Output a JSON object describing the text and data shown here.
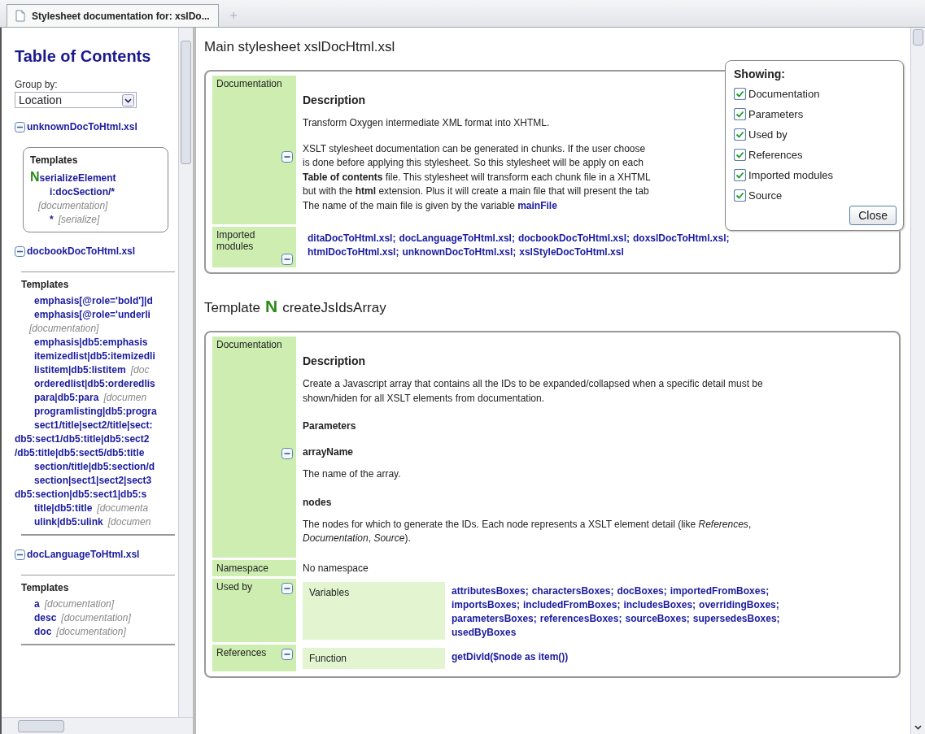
{
  "tabs": [
    {
      "title": "Stylesheet documentation for: xslDo...",
      "selected": true
    }
  ],
  "toc": {
    "title": "Table of Contents",
    "group_by_label": "Group by:",
    "group_by_value": "Location",
    "groups": [
      {
        "file": "unknownDocToHtml.xsl",
        "expanded": true,
        "kind": "boxed",
        "heading": "Templates",
        "entries": [
          {
            "kind": "name",
            "badge": "N",
            "text": "serializeElement"
          },
          {
            "kind": "sub",
            "text": "i:docSection/*"
          },
          {
            "kind": "note",
            "note": "[documentation]"
          },
          {
            "kind": "sub",
            "text": "*",
            "note": "[serialize]"
          }
        ]
      },
      {
        "file": "docbookDocToHtml.xsl",
        "expanded": true,
        "kind": "ruled",
        "heading": "Templates",
        "entries": [
          {
            "kind": "name",
            "text": "emphasis[@role='bold']|d"
          },
          {
            "kind": "name",
            "text": "emphasis[@role='underli"
          },
          {
            "kind": "note",
            "note": "[documentation]"
          },
          {
            "kind": "name",
            "text": "emphasis|db5:emphasis"
          },
          {
            "kind": "name",
            "text": "itemizedlist|db5:itemizedli"
          },
          {
            "kind": "name",
            "text": "listitem|db5:listitem",
            "note": "[doc"
          },
          {
            "kind": "name",
            "text": "orderedlist|db5:orderedlis"
          },
          {
            "kind": "name",
            "text": "para|db5:para",
            "note": "[documen"
          },
          {
            "kind": "name",
            "text": "programlisting|db5:progra"
          },
          {
            "kind": "name",
            "text": "sect1/title|sect2/title|sect:"
          },
          {
            "kind": "cont",
            "text": "db5:sect1/db5:title|db5:sect2"
          },
          {
            "kind": "cont",
            "text": "/db5:title|db5:sect5/db5:title"
          },
          {
            "kind": "name",
            "text": "section/title|db5:section/d"
          },
          {
            "kind": "name",
            "text": "section|sect1|sect2|sect3"
          },
          {
            "kind": "cont",
            "text": "db5:section|db5:sect1|db5:s"
          },
          {
            "kind": "name",
            "text": "title|db5:title",
            "note": "[documenta"
          },
          {
            "kind": "name",
            "text": "ulink|db5:ulink",
            "note": "[documen"
          }
        ]
      },
      {
        "file": "docLanguageToHtml.xsl",
        "expanded": true,
        "kind": "ruled",
        "heading": "Templates",
        "entries": [
          {
            "kind": "name",
            "text": "a",
            "note": "[documentation]"
          },
          {
            "kind": "name",
            "text": "desc",
            "note": "[documentation]"
          },
          {
            "kind": "name",
            "text": "doc",
            "note": "[documentation]"
          }
        ]
      }
    ]
  },
  "sections": [
    {
      "heading": "Main stylesheet xslDocHtml.xsl",
      "rows": [
        {
          "kind": "doc",
          "label": "Documentation",
          "expanded": true,
          "blocks": [
            {
              "kind": "heading",
              "text": "Description"
            },
            {
              "kind": "para",
              "lines": [
                "Transform Oxygen intermediate XML format into XHTML."
              ]
            },
            {
              "kind": "para",
              "lines": [
                "XSLT stylesheet documentation can be generated in chunks. If the user choose",
                "is done before applying this stylesheet. So this stylesheet will be apply on each",
                "**Table of contents** file. This stylesheet will transform each chunk file in a XHTML",
                "but with the **html** extension. Plus it will create a main file that will present the tab",
                "The name of the main file is given by the variable "
              ],
              "link": "mainFile"
            }
          ]
        },
        {
          "kind": "links",
          "label": "Imported modules",
          "expanded": true,
          "lines": [
            [
              "ditaDocToHtml.xsl;",
              "docLanguageToHtml.xsl;",
              "docbookDocToHtml.xsl;",
              "doxslDocToHtml.xsl;"
            ],
            [
              "htmlDocToHtml.xsl;",
              "unknownDocToHtml.xsl;",
              "xslStyleDocToHtml.xsl"
            ]
          ]
        }
      ]
    },
    {
      "heading": "Template",
      "badge": "N",
      "name": "createJsIdsArray",
      "rows": [
        {
          "kind": "doc",
          "label": "Documentation",
          "expanded": true,
          "blocks": [
            {
              "kind": "heading",
              "text": "Description"
            },
            {
              "kind": "para",
              "lines": [
                "Create a Javascript array that contains all the IDs to be expanded/collapsed when a specific detail must be",
                "shown/hiden for all XSLT elements from documentation."
              ]
            },
            {
              "kind": "subheading",
              "text": "Parameters"
            },
            {
              "kind": "subheading",
              "text": "arrayName"
            },
            {
              "kind": "para",
              "lines": [
                "The name of the array."
              ]
            },
            {
              "kind": "subheading",
              "text": "nodes"
            },
            {
              "kind": "para",
              "lines": [
                "The nodes for which to generate the IDs. Each node represents a XSLT element detail (like *References*,",
                "*Documentation*, *Source*)."
              ]
            }
          ]
        },
        {
          "kind": "text",
          "label": "Namespace",
          "text": "No namespace"
        },
        {
          "kind": "subtable",
          "label": "Used by",
          "expanded": true,
          "entries": [
            {
              "label": "Variables",
              "lines": [
                [
                  "attributesBoxes;",
                  "charactersBoxes;",
                  "docBoxes;",
                  "importedFromBoxes;"
                ],
                [
                  "importsBoxes;",
                  "includedFromBoxes;",
                  "includesBoxes;",
                  "overridingBoxes;"
                ],
                [
                  "parametersBoxes;",
                  "referencesBoxes;",
                  "sourceBoxes;",
                  "supersedesBoxes;"
                ],
                [
                  "usedByBoxes"
                ]
              ]
            }
          ]
        },
        {
          "kind": "subtable",
          "label": "References",
          "expanded": true,
          "entries": [
            {
              "label": "Function",
              "lines": [
                [
                  "getDivId($node as item())"
                ]
              ]
            }
          ]
        }
      ]
    }
  ],
  "showing": {
    "title": "Showing:",
    "items": [
      {
        "label": "Documentation",
        "checked": true
      },
      {
        "label": "Parameters",
        "checked": true
      },
      {
        "label": "Used by",
        "checked": true
      },
      {
        "label": "References",
        "checked": true
      },
      {
        "label": "Imported modules",
        "checked": true
      },
      {
        "label": "Source",
        "checked": true
      }
    ],
    "button": "Close"
  }
}
